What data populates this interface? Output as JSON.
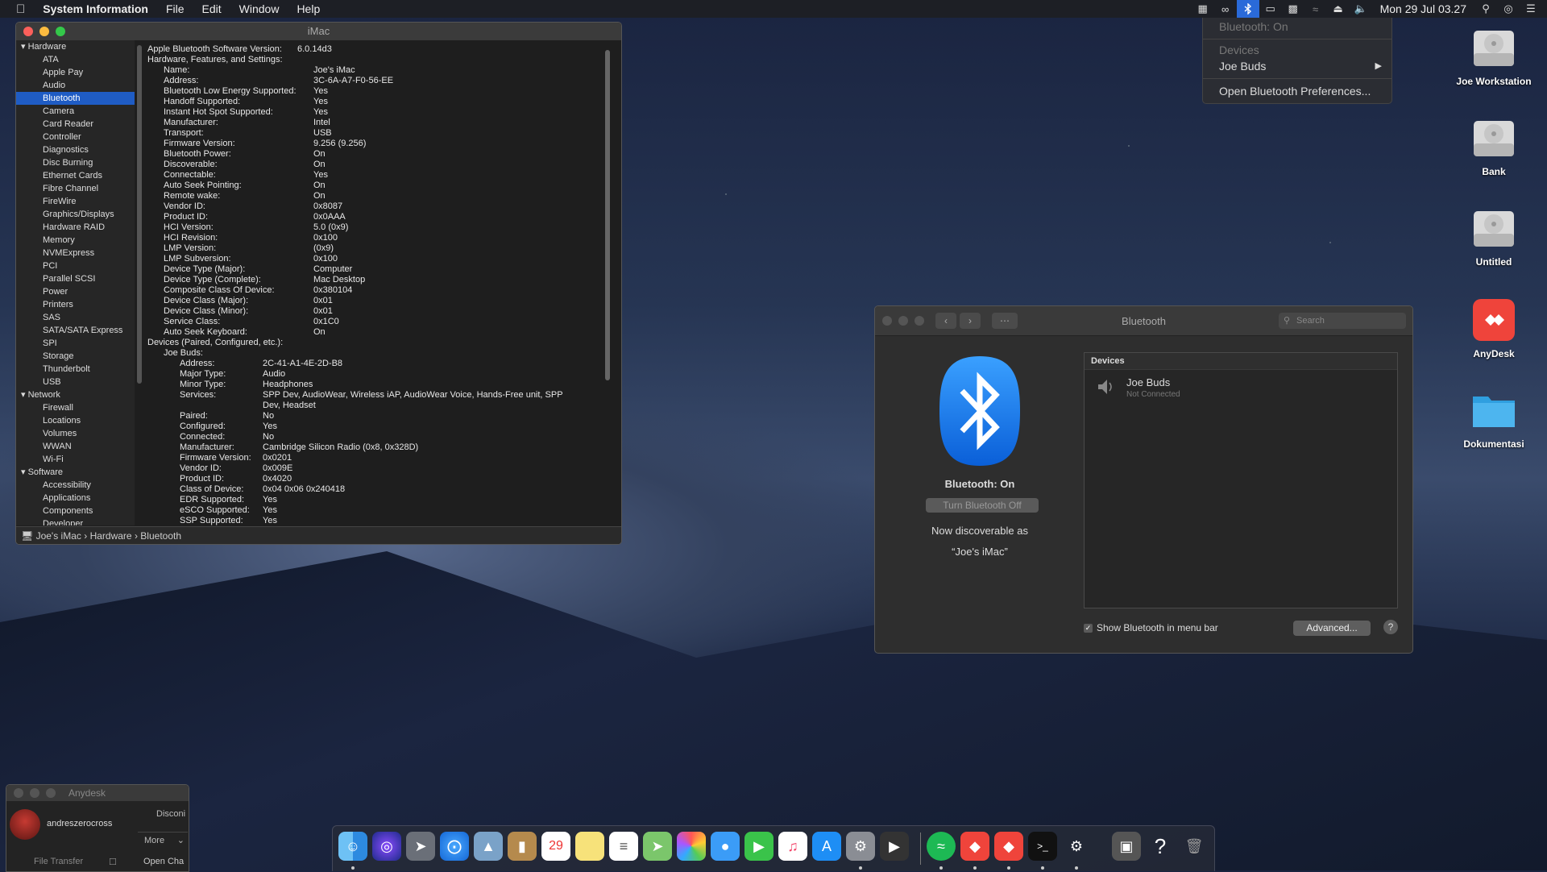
{
  "menubar": {
    "app_name": "System Information",
    "menus": [
      "File",
      "Edit",
      "Window",
      "Help"
    ],
    "clock": "Mon 29 Jul  03.27"
  },
  "bt_menu": {
    "status": "Bluetooth: On",
    "devices_header": "Devices",
    "device": "Joe Buds",
    "open_prefs": "Open Bluetooth Preferences..."
  },
  "sysinfo": {
    "title": "iMac",
    "sidebar": {
      "hardware_label": "Hardware",
      "hardware": [
        "ATA",
        "Apple Pay",
        "Audio",
        "Bluetooth",
        "Camera",
        "Card Reader",
        "Controller",
        "Diagnostics",
        "Disc Burning",
        "Ethernet Cards",
        "Fibre Channel",
        "FireWire",
        "Graphics/Displays",
        "Hardware RAID",
        "Memory",
        "NVMExpress",
        "PCI",
        "Parallel SCSI",
        "Power",
        "Printers",
        "SAS",
        "SATA/SATA Express",
        "SPI",
        "Storage",
        "Thunderbolt",
        "USB"
      ],
      "network_label": "Network",
      "network": [
        "Firewall",
        "Locations",
        "Volumes",
        "WWAN",
        "Wi-Fi"
      ],
      "software_label": "Software",
      "software": [
        "Accessibility",
        "Applications",
        "Components",
        "Developer"
      ],
      "selected": "Bluetooth"
    },
    "content": {
      "header1": "Apple Bluetooth Software Version:",
      "header1_value": "6.0.14d3",
      "header2": "Hardware, Features, and Settings:",
      "hw": [
        [
          "Name:",
          "Joe's iMac"
        ],
        [
          "Address:",
          "3C-6A-A7-F0-56-EE"
        ],
        [
          "Bluetooth Low Energy Supported:",
          "Yes"
        ],
        [
          "Handoff Supported:",
          "Yes"
        ],
        [
          "Instant Hot Spot Supported:",
          "Yes"
        ],
        [
          "Manufacturer:",
          "Intel"
        ],
        [
          "Transport:",
          "USB"
        ],
        [
          "Firmware Version:",
          "9.256 (9.256)"
        ],
        [
          "Bluetooth Power:",
          "On"
        ],
        [
          "Discoverable:",
          "On"
        ],
        [
          "Connectable:",
          "Yes"
        ],
        [
          "Auto Seek Pointing:",
          "On"
        ],
        [
          "Remote wake:",
          "On"
        ],
        [
          "Vendor ID:",
          "0x8087"
        ],
        [
          "Product ID:",
          "0x0AAA"
        ],
        [
          "HCI Version:",
          "5.0 (0x9)"
        ],
        [
          "HCI Revision:",
          "0x100"
        ],
        [
          "LMP Version:",
          "(0x9)"
        ],
        [
          "LMP Subversion:",
          "0x100"
        ],
        [
          "Device Type (Major):",
          "Computer"
        ],
        [
          "Device Type (Complete):",
          "Mac Desktop"
        ],
        [
          "Composite Class Of Device:",
          "0x380104"
        ],
        [
          "Device Class (Major):",
          "0x01"
        ],
        [
          "Device Class (Minor):",
          "0x01"
        ],
        [
          "Service Class:",
          "0x1C0"
        ],
        [
          "Auto Seek Keyboard:",
          "On"
        ]
      ],
      "header3": "Devices (Paired, Configured, etc.):",
      "device_name": "Joe Buds:",
      "dev": [
        [
          "Address:",
          "2C-41-A1-4E-2D-B8"
        ],
        [
          "Major Type:",
          "Audio"
        ],
        [
          "Minor Type:",
          "Headphones"
        ],
        [
          "Services:",
          "SPP Dev, AudioWear, Wireless iAP, AudioWear Voice, Hands-Free unit, SPP"
        ],
        [
          "",
          "Dev, Headset"
        ],
        [
          "Paired:",
          "No"
        ],
        [
          "Configured:",
          "Yes"
        ],
        [
          "Connected:",
          "No"
        ],
        [
          "Manufacturer:",
          "Cambridge Silicon Radio (0x8, 0x328D)"
        ],
        [
          "Firmware Version:",
          "0x0201"
        ],
        [
          "Vendor ID:",
          "0x009E"
        ],
        [
          "Product ID:",
          "0x4020"
        ],
        [
          "Class of Device:",
          "0x04 0x06 0x240418"
        ],
        [
          "EDR Supported:",
          "Yes"
        ],
        [
          "eSCO Supported:",
          "Yes"
        ],
        [
          "SSP Supported:",
          "Yes"
        ]
      ]
    },
    "pathbar": [
      "Joe's iMac",
      "Hardware",
      "Bluetooth"
    ]
  },
  "bt_prefs": {
    "title": "Bluetooth",
    "search_placeholder": "Search",
    "status": "Bluetooth: On",
    "toggle_label": "Turn Bluetooth Off",
    "discoverable_line1": "Now discoverable as",
    "discoverable_line2": "“Joe's iMac”",
    "devices_header": "Devices",
    "device_name": "Joe Buds",
    "device_status": "Not Connected",
    "show_in_menubar": "Show Bluetooth in menu bar",
    "advanced": "Advanced...",
    "help": "?"
  },
  "desktop": {
    "icons": [
      "Joe Workstation",
      "Bank",
      "Untitled",
      "AnyDesk",
      "Dokumentasi"
    ]
  },
  "anydesk": {
    "title": "Anydesk",
    "user": "andreszerocross",
    "disconnect": "Disconi",
    "more": "More",
    "file_transfer": "File Transfer",
    "open_chat": "Open Cha"
  },
  "colors": {
    "accent": "#2a6ad9",
    "bluetooth_blue": "#1e7ef0",
    "anydesk_red": "#ef443b"
  }
}
